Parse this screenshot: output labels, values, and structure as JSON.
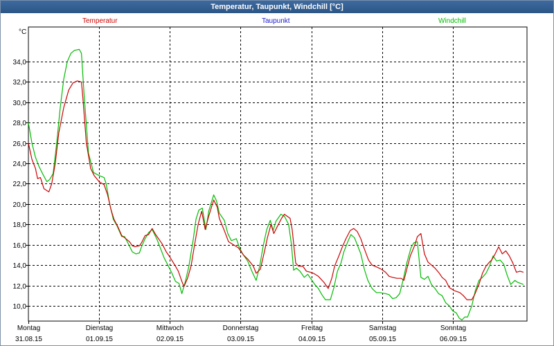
{
  "window": {
    "title": "Temperatur, Taupunkt, Windchill [°C]"
  },
  "chart_data": {
    "type": "line",
    "title": "Temperatur, Taupunkt, Windchill [°C]",
    "ylabel": "°C",
    "ylim": [
      8.5,
      37.4
    ],
    "y_ticks": [
      "10,0",
      "12,0",
      "14,0",
      "16,0",
      "18,0",
      "20,0",
      "22,0",
      "24,0",
      "26,0",
      "28,0",
      "30,0",
      "32,0",
      "34,0"
    ],
    "y_tick_values": [
      10,
      12,
      14,
      16,
      18,
      20,
      22,
      24,
      26,
      28,
      30,
      32,
      34
    ],
    "xlim": [
      0,
      7.05
    ],
    "days": [
      {
        "name": "Montag",
        "date": "31.08.15"
      },
      {
        "name": "Dienstag",
        "date": "01.09.15"
      },
      {
        "name": "Mittwoch",
        "date": "02.09.15"
      },
      {
        "name": "Donnerstag",
        "date": "03.09.15"
      },
      {
        "name": "Freitag",
        "date": "04.09.15"
      },
      {
        "name": "Samstag",
        "date": "05.09.15"
      },
      {
        "name": "Sonntag",
        "date": "06.09.15"
      }
    ],
    "grid": true,
    "legend_position": "top",
    "series": [
      {
        "name": "Temperatur",
        "color": "#cc0000",
        "points": [
          [
            0,
            26
          ],
          [
            0.05,
            24.4
          ],
          [
            0.1,
            23.5
          ],
          [
            0.13,
            22.5
          ],
          [
            0.17,
            22.6
          ],
          [
            0.22,
            21.5
          ],
          [
            0.29,
            21.2
          ],
          [
            0.33,
            22
          ],
          [
            0.38,
            24
          ],
          [
            0.43,
            27
          ],
          [
            0.5,
            29.5
          ],
          [
            0.57,
            31.2
          ],
          [
            0.63,
            31.9
          ],
          [
            0.69,
            32.1
          ],
          [
            0.75,
            32
          ],
          [
            0.77,
            30.5
          ],
          [
            0.82,
            26
          ],
          [
            0.88,
            23.5
          ],
          [
            0.93,
            22.8
          ],
          [
            1.0,
            22.2
          ],
          [
            1.07,
            21.9
          ],
          [
            1.12,
            20.9
          ],
          [
            1.17,
            19.4
          ],
          [
            1.21,
            18.5
          ],
          [
            1.27,
            17.7
          ],
          [
            1.32,
            16.9
          ],
          [
            1.36,
            16.7
          ],
          [
            1.43,
            16.3
          ],
          [
            1.47,
            15.9
          ],
          [
            1.51,
            15.8
          ],
          [
            1.57,
            15.9
          ],
          [
            1.6,
            16.2
          ],
          [
            1.65,
            16.9
          ],
          [
            1.7,
            17.0
          ],
          [
            1.75,
            17.6
          ],
          [
            1.8,
            17.0
          ],
          [
            1.89,
            16.1
          ],
          [
            1.95,
            15.3
          ],
          [
            2.0,
            14.8
          ],
          [
            2.07,
            14.0
          ],
          [
            2.12,
            13.4
          ],
          [
            2.17,
            12.4
          ],
          [
            2.2,
            11.9
          ],
          [
            2.25,
            12.7
          ],
          [
            2.3,
            13.9
          ],
          [
            2.35,
            16.0
          ],
          [
            2.4,
            18.0
          ],
          [
            2.45,
            19.3
          ],
          [
            2.5,
            17.5
          ],
          [
            2.55,
            18.8
          ],
          [
            2.62,
            20.4
          ],
          [
            2.67,
            19.7
          ],
          [
            2.7,
            18.6
          ],
          [
            2.77,
            17.4
          ],
          [
            2.83,
            16.3
          ],
          [
            2.9,
            16.0
          ],
          [
            2.97,
            15.7
          ],
          [
            3.04,
            15.0
          ],
          [
            3.1,
            14.6
          ],
          [
            3.18,
            13.9
          ],
          [
            3.22,
            13.2
          ],
          [
            3.28,
            13.6
          ],
          [
            3.34,
            15.4
          ],
          [
            3.38,
            16.7
          ],
          [
            3.43,
            18.0
          ],
          [
            3.47,
            17.1
          ],
          [
            3.52,
            17.8
          ],
          [
            3.58,
            18.6
          ],
          [
            3.62,
            19.0
          ],
          [
            3.7,
            18.6
          ],
          [
            3.73,
            17.5
          ],
          [
            3.78,
            14.2
          ],
          [
            3.82,
            13.9
          ],
          [
            3.88,
            13.9
          ],
          [
            3.93,
            13.4
          ],
          [
            3.99,
            13.3
          ],
          [
            4.03,
            13.2
          ],
          [
            4.1,
            12.9
          ],
          [
            4.14,
            12.6
          ],
          [
            4.18,
            12.3
          ],
          [
            4.24,
            11.7
          ],
          [
            4.29,
            12.7
          ],
          [
            4.33,
            13.9
          ],
          [
            4.39,
            14.9
          ],
          [
            4.44,
            15.8
          ],
          [
            4.49,
            16.6
          ],
          [
            4.55,
            17.4
          ],
          [
            4.6,
            17.6
          ],
          [
            4.65,
            17.3
          ],
          [
            4.7,
            16.6
          ],
          [
            4.75,
            15.6
          ],
          [
            4.81,
            14.5
          ],
          [
            4.86,
            14.0
          ],
          [
            4.93,
            13.8
          ],
          [
            4.99,
            13.6
          ],
          [
            5.05,
            13.3
          ],
          [
            5.1,
            12.9
          ],
          [
            5.15,
            12.8
          ],
          [
            5.21,
            12.7
          ],
          [
            5.27,
            12.7
          ],
          [
            5.31,
            12.5
          ],
          [
            5.35,
            13.6
          ],
          [
            5.4,
            14.9
          ],
          [
            5.46,
            15.9
          ],
          [
            5.5,
            16.8
          ],
          [
            5.55,
            17.1
          ],
          [
            5.6,
            15.1
          ],
          [
            5.65,
            14.3
          ],
          [
            5.7,
            14.0
          ],
          [
            5.75,
            13.7
          ],
          [
            5.81,
            13.2
          ],
          [
            5.85,
            12.8
          ],
          [
            5.9,
            12.5
          ],
          [
            5.95,
            11.8
          ],
          [
            6.02,
            11.5
          ],
          [
            6.1,
            11.3
          ],
          [
            6.15,
            11.0
          ],
          [
            6.2,
            10.6
          ],
          [
            6.27,
            10.6
          ],
          [
            6.31,
            11.1
          ],
          [
            6.37,
            12.1
          ],
          [
            6.42,
            13.2
          ],
          [
            6.47,
            13.9
          ],
          [
            6.52,
            14.3
          ],
          [
            6.55,
            14.5
          ],
          [
            6.6,
            15.1
          ],
          [
            6.65,
            15.8
          ],
          [
            6.7,
            15.1
          ],
          [
            6.75,
            15.4
          ],
          [
            6.8,
            14.9
          ],
          [
            6.85,
            14.2
          ],
          [
            6.9,
            13.3
          ],
          [
            6.95,
            13.4
          ],
          [
            7.0,
            13.3
          ]
        ]
      },
      {
        "name": "Windchill",
        "color": "#00bb00",
        "points": [
          [
            0,
            28
          ],
          [
            0.05,
            26
          ],
          [
            0.1,
            24.6
          ],
          [
            0.15,
            23.7
          ],
          [
            0.2,
            23.0
          ],
          [
            0.26,
            22.2
          ],
          [
            0.3,
            22.4
          ],
          [
            0.35,
            23.0
          ],
          [
            0.4,
            26.0
          ],
          [
            0.45,
            29.5
          ],
          [
            0.5,
            32.3
          ],
          [
            0.55,
            34.0
          ],
          [
            0.6,
            34.8
          ],
          [
            0.65,
            35.1
          ],
          [
            0.72,
            35.2
          ],
          [
            0.75,
            34.8
          ],
          [
            0.79,
            30.5
          ],
          [
            0.85,
            25.0
          ],
          [
            0.92,
            23.1
          ],
          [
            1.0,
            22.8
          ],
          [
            1.07,
            22.6
          ],
          [
            1.1,
            22.0
          ],
          [
            1.15,
            20.0
          ],
          [
            1.2,
            18.5
          ],
          [
            1.25,
            17.9
          ],
          [
            1.32,
            16.8
          ],
          [
            1.36,
            16.8
          ],
          [
            1.42,
            16.0
          ],
          [
            1.47,
            15.3
          ],
          [
            1.52,
            15.1
          ],
          [
            1.57,
            15.2
          ],
          [
            1.6,
            15.8
          ],
          [
            1.65,
            16.6
          ],
          [
            1.7,
            17.2
          ],
          [
            1.75,
            17.5
          ],
          [
            1.82,
            16.5
          ],
          [
            1.87,
            15.6
          ],
          [
            1.92,
            14.7
          ],
          [
            1.98,
            13.9
          ],
          [
            2.03,
            13.2
          ],
          [
            2.08,
            12.4
          ],
          [
            2.13,
            12.2
          ],
          [
            2.17,
            11.2
          ],
          [
            2.22,
            12.4
          ],
          [
            2.27,
            13.9
          ],
          [
            2.33,
            16.5
          ],
          [
            2.37,
            18.5
          ],
          [
            2.41,
            19.4
          ],
          [
            2.46,
            19.6
          ],
          [
            2.51,
            17.5
          ],
          [
            2.55,
            19.3
          ],
          [
            2.62,
            20.9
          ],
          [
            2.66,
            20.3
          ],
          [
            2.7,
            19.1
          ],
          [
            2.77,
            18.4
          ],
          [
            2.82,
            17.1
          ],
          [
            2.87,
            16.4
          ],
          [
            2.94,
            16.6
          ],
          [
            2.98,
            15.8
          ],
          [
            3.03,
            15.1
          ],
          [
            3.1,
            14.4
          ],
          [
            3.16,
            13.4
          ],
          [
            3.22,
            12.5
          ],
          [
            3.27,
            13.9
          ],
          [
            3.32,
            15.9
          ],
          [
            3.37,
            17.5
          ],
          [
            3.42,
            18.4
          ],
          [
            3.46,
            17.4
          ],
          [
            3.5,
            18.3
          ],
          [
            3.57,
            19.0
          ],
          [
            3.62,
            18.8
          ],
          [
            3.68,
            18.0
          ],
          [
            3.72,
            16.0
          ],
          [
            3.75,
            13.5
          ],
          [
            3.79,
            13.7
          ],
          [
            3.84,
            13.4
          ],
          [
            3.9,
            12.8
          ],
          [
            3.95,
            13.1
          ],
          [
            4.0,
            12.6
          ],
          [
            4.05,
            12.1
          ],
          [
            4.1,
            11.7
          ],
          [
            4.15,
            11.1
          ],
          [
            4.2,
            10.6
          ],
          [
            4.27,
            10.6
          ],
          [
            4.32,
            11.8
          ],
          [
            4.37,
            13.4
          ],
          [
            4.42,
            14.2
          ],
          [
            4.46,
            15.3
          ],
          [
            4.51,
            16.2
          ],
          [
            4.56,
            17.0
          ],
          [
            4.61,
            16.7
          ],
          [
            4.65,
            16.0
          ],
          [
            4.7,
            15.1
          ],
          [
            4.75,
            13.6
          ],
          [
            4.8,
            12.5
          ],
          [
            4.86,
            11.7
          ],
          [
            4.92,
            11.3
          ],
          [
            4.97,
            11.3
          ],
          [
            5.05,
            11.2
          ],
          [
            5.1,
            11.1
          ],
          [
            5.15,
            10.7
          ],
          [
            5.2,
            10.8
          ],
          [
            5.25,
            11.2
          ],
          [
            5.3,
            12.6
          ],
          [
            5.35,
            14.2
          ],
          [
            5.41,
            15.7
          ],
          [
            5.45,
            16.2
          ],
          [
            5.5,
            16.3
          ],
          [
            5.55,
            12.8
          ],
          [
            5.6,
            12.6
          ],
          [
            5.65,
            12.9
          ],
          [
            5.7,
            12.1
          ],
          [
            5.75,
            11.7
          ],
          [
            5.8,
            11.2
          ],
          [
            5.85,
            11.0
          ],
          [
            5.9,
            10.3
          ],
          [
            5.95,
            10.0
          ],
          [
            6.0,
            9.5
          ],
          [
            6.05,
            9.3
          ],
          [
            6.09,
            8.8
          ],
          [
            6.13,
            8.6
          ],
          [
            6.17,
            8.9
          ],
          [
            6.21,
            8.9
          ],
          [
            6.27,
            10.0
          ],
          [
            6.32,
            11.5
          ],
          [
            6.37,
            12.5
          ],
          [
            6.42,
            12.8
          ],
          [
            6.47,
            13.2
          ],
          [
            6.52,
            13.9
          ],
          [
            6.57,
            14.9
          ],
          [
            6.62,
            14.4
          ],
          [
            6.67,
            14.5
          ],
          [
            6.72,
            14.1
          ],
          [
            6.77,
            13.0
          ],
          [
            6.82,
            12.1
          ],
          [
            6.88,
            12.5
          ],
          [
            6.92,
            12.3
          ],
          [
            7.0,
            12.1
          ]
        ]
      }
    ],
    "legend_only_series": [
      {
        "name": "Taupunkt",
        "color": "#1a1acc"
      }
    ]
  }
}
